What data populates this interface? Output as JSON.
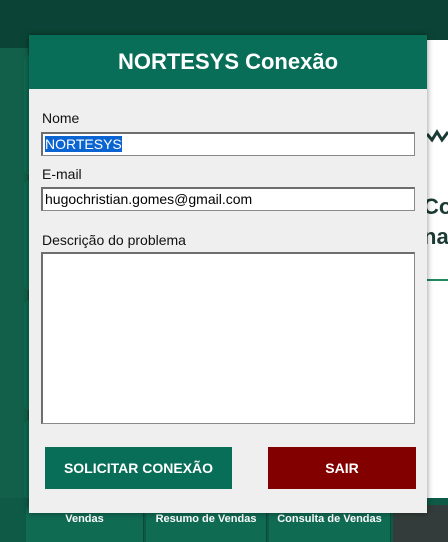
{
  "background": {
    "bottom_nav": [
      "Vendas",
      "Resumo de Vendas",
      "Consulta de Vendas"
    ],
    "right_fragments": [
      "Co",
      "na"
    ]
  },
  "dialog": {
    "title": "NORTESYS Conexão",
    "name_label": "Nome",
    "name_value": "NORTESYS",
    "email_label": "E-mail",
    "email_value": "hugochristian.gomes@gmail.com",
    "description_label": "Descrição do problema",
    "description_value": "",
    "request_button": "SOLICITAR CONEXÃO",
    "exit_button": "SAIR"
  },
  "colors": {
    "primary": "#086e57",
    "danger": "#820000",
    "selection": "#0a64d2"
  }
}
